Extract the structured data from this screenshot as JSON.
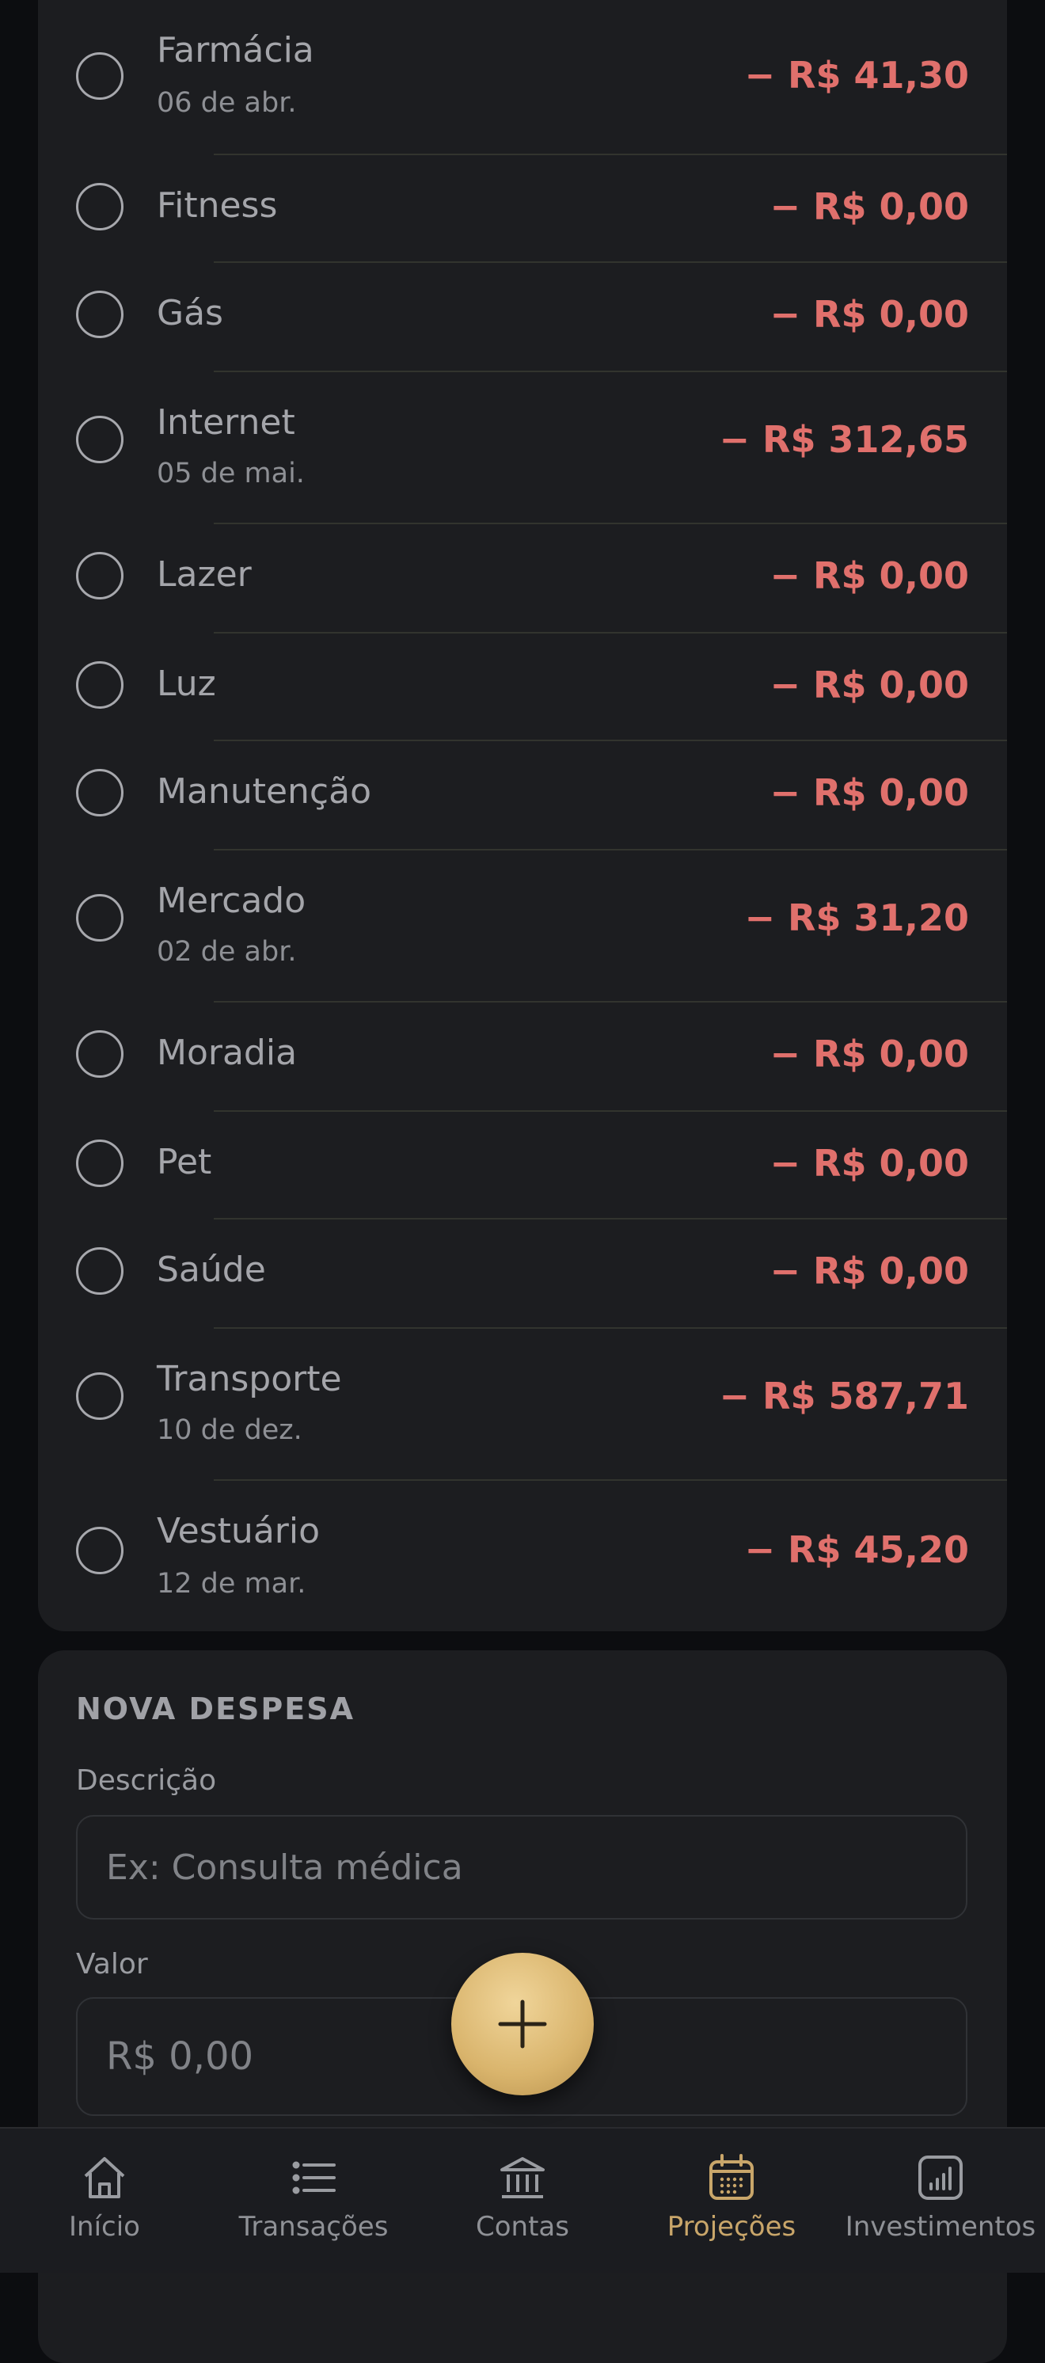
{
  "expenses": [
    {
      "title": "Farmácia",
      "date": "06 de abr.",
      "amount": "− R$ 41,30"
    },
    {
      "title": "Fitness",
      "date": "",
      "amount": "− R$ 0,00"
    },
    {
      "title": "Gás",
      "date": "",
      "amount": "− R$ 0,00"
    },
    {
      "title": "Internet",
      "date": "05 de mai.",
      "amount": "− R$ 312,65"
    },
    {
      "title": "Lazer",
      "date": "",
      "amount": "− R$ 0,00"
    },
    {
      "title": "Luz",
      "date": "",
      "amount": "− R$ 0,00"
    },
    {
      "title": "Manutenção",
      "date": "",
      "amount": "− R$ 0,00"
    },
    {
      "title": "Mercado",
      "date": "02 de abr.",
      "amount": "− R$ 31,20"
    },
    {
      "title": "Moradia",
      "date": "",
      "amount": "− R$ 0,00"
    },
    {
      "title": "Pet",
      "date": "",
      "amount": "− R$ 0,00"
    },
    {
      "title": "Saúde",
      "date": "",
      "amount": "− R$ 0,00"
    },
    {
      "title": "Transporte",
      "date": "10 de dez.",
      "amount": "− R$ 587,71"
    },
    {
      "title": "Vestuário",
      "date": "12 de mar.",
      "amount": "− R$ 45,20"
    }
  ],
  "form": {
    "section_title": "NOVA DESPESA",
    "description_label": "Descrição",
    "description_placeholder": "Ex: Consulta médica",
    "value_label": "Valor",
    "value_placeholder": "R$ 0,00"
  },
  "fab": {
    "icon": "plus-icon"
  },
  "tabs": [
    {
      "label": "Início",
      "icon": "home-icon",
      "active": false
    },
    {
      "label": "Transações",
      "icon": "list-icon",
      "active": false
    },
    {
      "label": "Contas",
      "icon": "bank-icon",
      "active": false
    },
    {
      "label": "Projeções",
      "icon": "calendar-icon",
      "active": true
    },
    {
      "label": "Investimentos",
      "icon": "chart-icon",
      "active": false
    }
  ],
  "colors": {
    "background": "#0c0d10",
    "card": "#1c1d20",
    "negative_amount": "#e0706c",
    "accent": "#c9a66a",
    "fab": "#d9b46c"
  }
}
